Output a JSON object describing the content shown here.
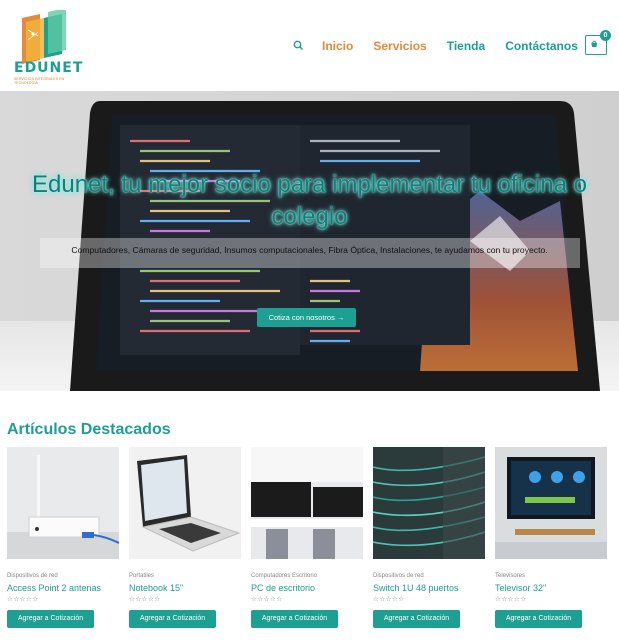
{
  "brand": {
    "name": "EDUNET",
    "tagline": "SERVICIOS INTEGRALES EN TECNOLOGÍA",
    "accent": "#1d9f92",
    "orange": "#e58a3a"
  },
  "nav": {
    "search_icon": "search-icon",
    "items": [
      {
        "label": "Inicio"
      },
      {
        "label": "Servicios"
      },
      {
        "label": "Tienda"
      },
      {
        "label": "Contáctanos"
      }
    ],
    "cart_count": "0"
  },
  "hero": {
    "title": "Edunet, tu mejor socio para implementar tu oficina o colegio",
    "subtitle": "Computadores, Cámaras de seguridad, Insumos computacionales, Fibra Óptica, Instalaciones, te ayudamos con tu proyecto.",
    "cta": "Cotiza con nosotros →"
  },
  "featured": {
    "title": "Artículos Destacados",
    "products": [
      {
        "category": "Dispositivos de red",
        "name": "Access Point 2 antenas",
        "rating": "☆☆☆☆☆",
        "button": "Agregar a Cotización"
      },
      {
        "category": "Portatiles",
        "name": "Notebook 15\"",
        "rating": "☆☆☆☆☆",
        "button": "Agregar a Cotización"
      },
      {
        "category": "Computadores Escritorio",
        "name": "PC de escritorio",
        "rating": "☆☆☆☆☆",
        "button": "Agregar a Cotización"
      },
      {
        "category": "Dispositivos de red",
        "name": "Switch 1U 48 puertos",
        "rating": "☆☆☆☆☆",
        "button": "Agregar a Cotización"
      },
      {
        "category": "Televisores",
        "name": "Televisor 32\"",
        "rating": "☆☆☆☆☆",
        "button": "Agregar a Cotización"
      }
    ]
  }
}
